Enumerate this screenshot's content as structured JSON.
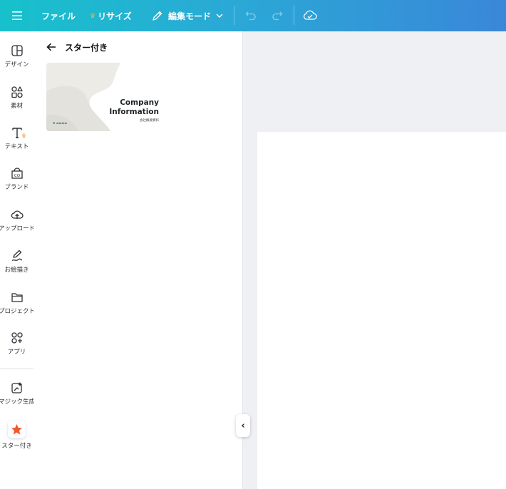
{
  "topbar": {
    "file_label": "ファイル",
    "resize_label": "リサイズ",
    "edit_mode_label": "編集モード",
    "icons": [
      "menu-icon",
      "crown-icon",
      "pencil-icon",
      "chevron-down-icon",
      "undo-icon",
      "redo-icon",
      "cloud-check-icon"
    ]
  },
  "sidebar": {
    "items": [
      {
        "label": "デザイン",
        "icon": "design-icon"
      },
      {
        "label": "素材",
        "icon": "elements-icon"
      },
      {
        "label": "テキスト",
        "icon": "text-icon"
      },
      {
        "label": "ブランド",
        "icon": "brand-icon"
      },
      {
        "label": "アップロード",
        "icon": "upload-icon"
      },
      {
        "label": "お絵描き",
        "icon": "draw-icon"
      },
      {
        "label": "プロジェクト",
        "icon": "folder-icon"
      },
      {
        "label": "アプリ",
        "icon": "apps-icon"
      },
      {
        "label": "マジック生成",
        "icon": "magic-icon"
      },
      {
        "label": "スター付き",
        "icon": "star-icon"
      }
    ]
  },
  "panel": {
    "title": "スター付き",
    "template": {
      "title_line1": "Company",
      "title_line2": "Information",
      "subtitle": "会社概要資料"
    }
  },
  "colors": {
    "topbar_start": "#17c1cb",
    "topbar_end": "#3a87d8",
    "canvas_bg": "#eff0f4",
    "star": "#f3582c",
    "crown": "#f4b13a"
  }
}
